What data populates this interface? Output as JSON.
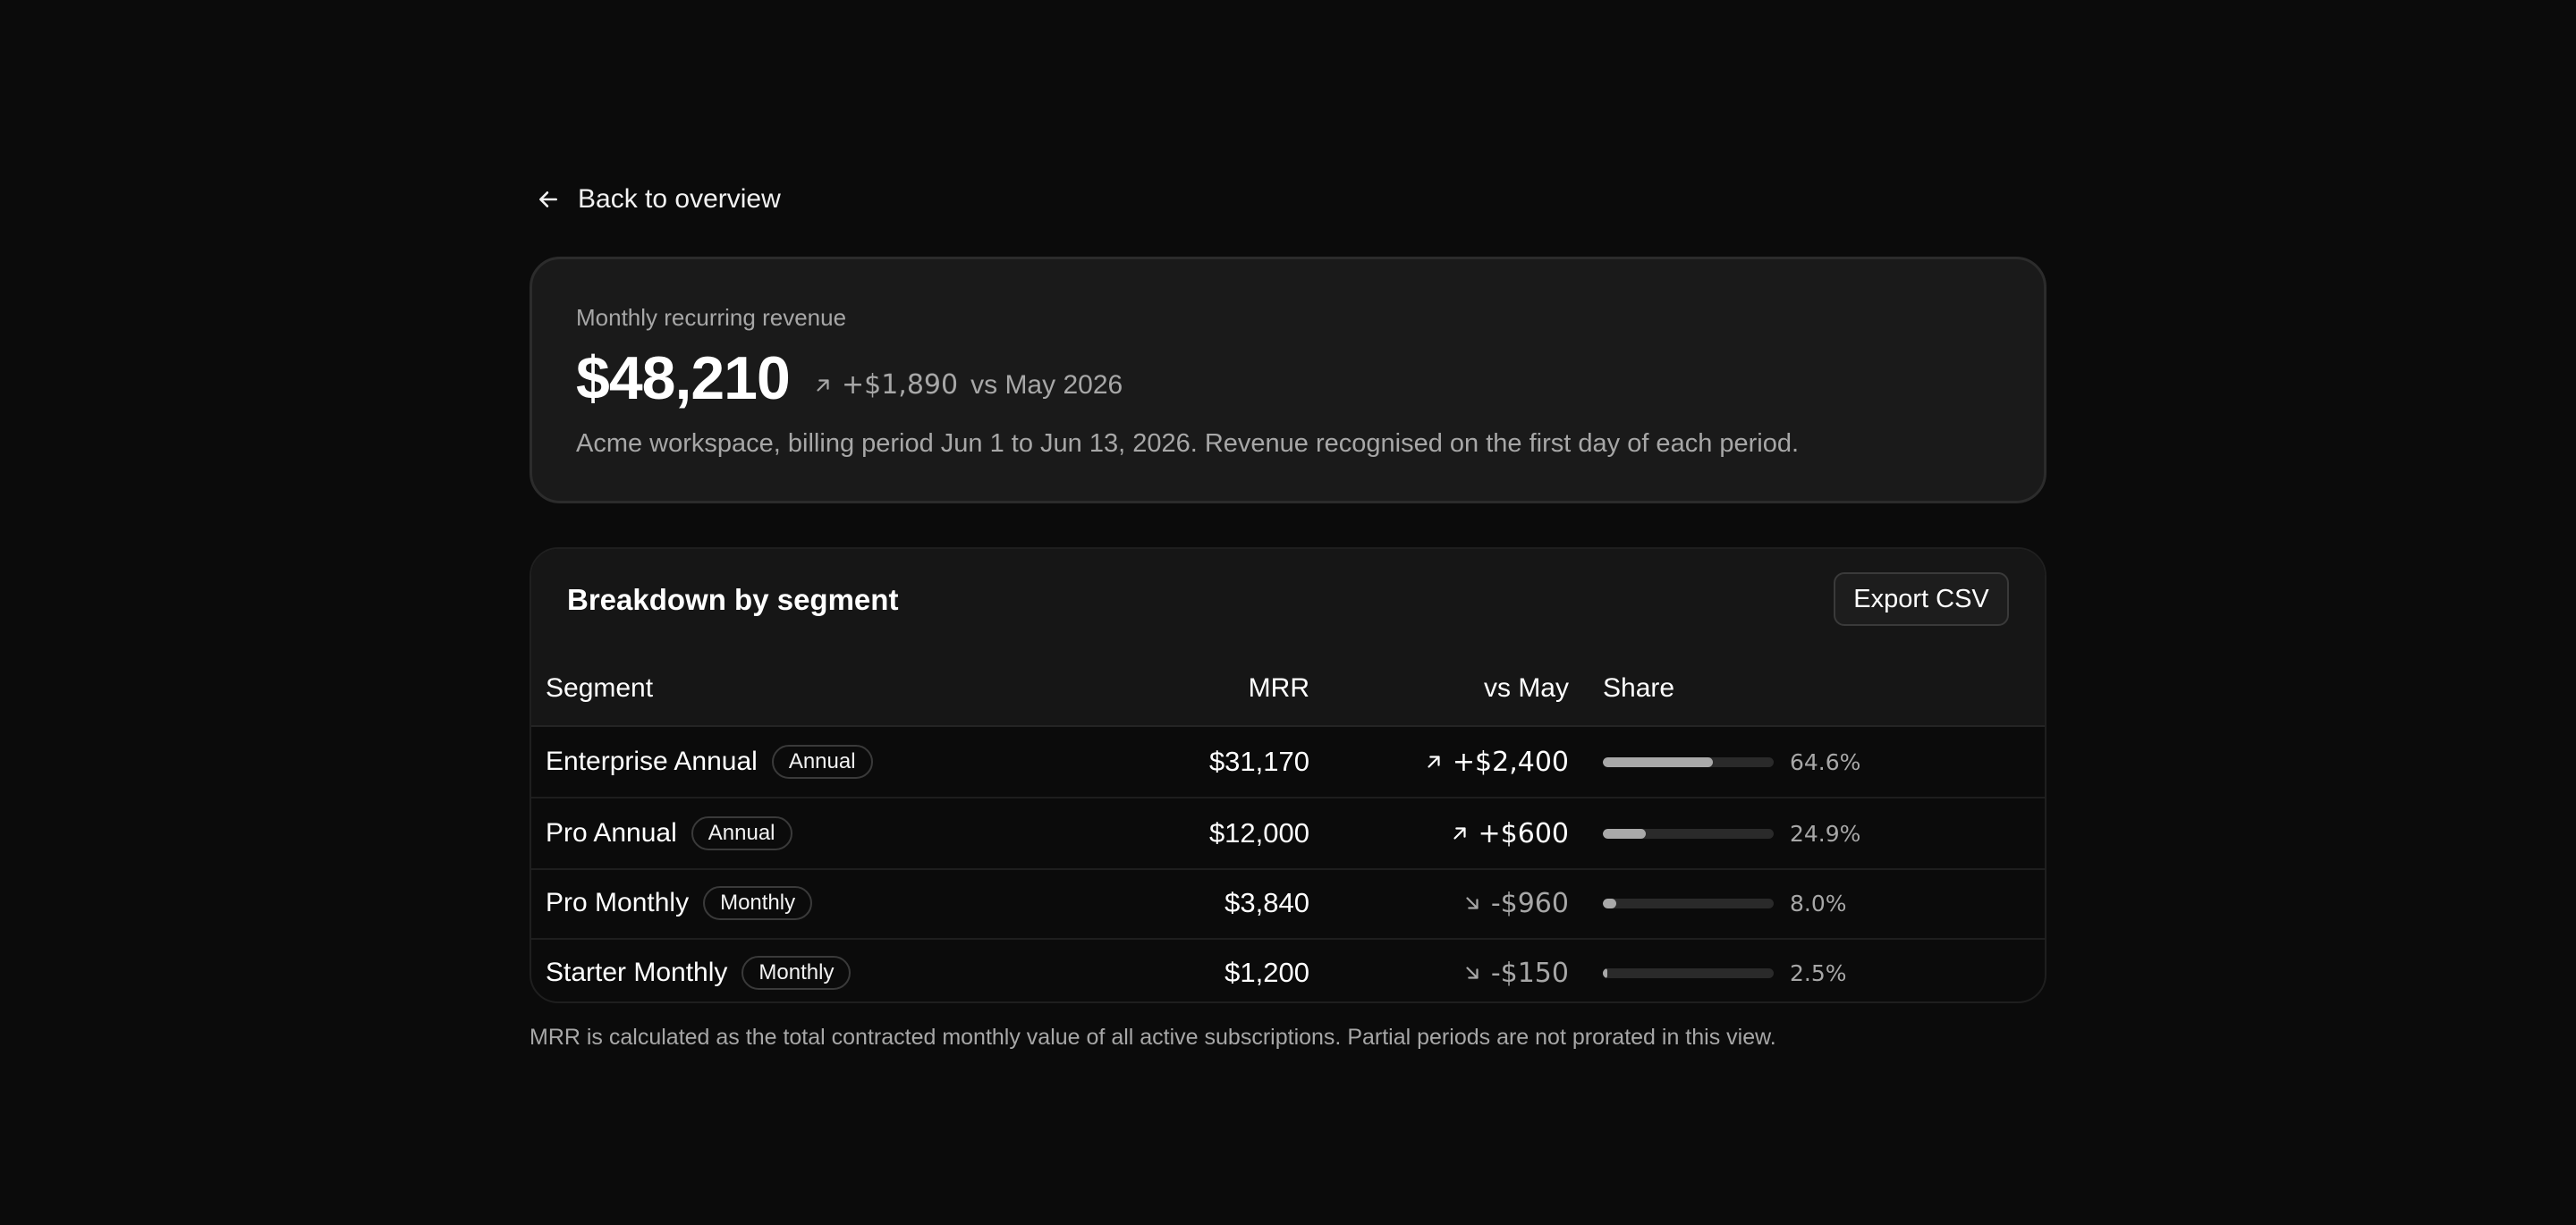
{
  "nav": {
    "back_label": "Back to overview",
    "back_icon": "arrow-left-icon"
  },
  "summary": {
    "label": "Monthly recurring revenue",
    "value": "$48,210",
    "delta": "+$1,890",
    "delta_direction": "up",
    "comparison": "vs May 2026",
    "description": "Acme workspace, billing period Jun 1 to Jun 13, 2026. Revenue recognised on the first day of each period."
  },
  "breakdown": {
    "title": "Breakdown by segment",
    "export_label": "Export CSV",
    "columns": {
      "segment": "Segment",
      "mrr": "MRR",
      "vs": "vs May",
      "share": "Share"
    },
    "rows": [
      {
        "segment": "Enterprise Annual",
        "plan": "Annual",
        "mrr": "$31,170",
        "delta": "+$2,400",
        "direction": "up",
        "share": 64.6,
        "share_label": "64.6%"
      },
      {
        "segment": "Pro Annual",
        "plan": "Annual",
        "mrr": "$12,000",
        "delta": "+$600",
        "direction": "up",
        "share": 24.9,
        "share_label": "24.9%"
      },
      {
        "segment": "Pro Monthly",
        "plan": "Monthly",
        "mrr": "$3,840",
        "delta": "-$960",
        "direction": "down",
        "share": 8.0,
        "share_label": "8.0%"
      },
      {
        "segment": "Starter Monthly",
        "plan": "Monthly",
        "mrr": "$1,200",
        "delta": "-$150",
        "direction": "down",
        "share": 2.5,
        "share_label": "2.5%"
      }
    ]
  },
  "footnote": "MRR is calculated as the total contracted monthly value of all active subscriptions. Partial periods are not prorated in this view.",
  "colors": {
    "background": "#0b0b0b",
    "card": "#1a1a1a",
    "bar_fill": "#a9a9a9",
    "muted_text": "#a7a7a7"
  }
}
